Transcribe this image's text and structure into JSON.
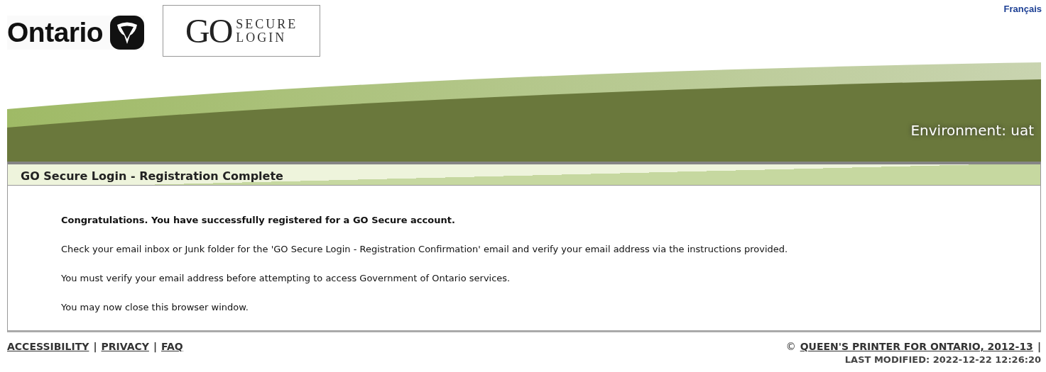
{
  "header": {
    "ontario_logo": "Ontario",
    "go_logo": {
      "mark": "GO",
      "line_1": "SECURE",
      "line_2": "LOGIN"
    },
    "language_link": "Français"
  },
  "banner": {
    "environment": "Environment: uat"
  },
  "page_title": "GO Secure Login - Registration Complete",
  "messages": [
    {
      "kind": "heading",
      "text": "Congratulations. You have successfully registered for a GO Secure account."
    },
    {
      "kind": "paragraph",
      "text": "Check your email inbox or Junk folder for the 'GO Secure Login - Registration Confirmation' email and verify your email address via the instructions provided."
    },
    {
      "kind": "paragraph",
      "text": "You must verify your email address before attempting to access Government of Ontario services."
    },
    {
      "kind": "paragraph",
      "text": "You may now close this browser window."
    }
  ],
  "footer": {
    "links": [
      "ACCESSIBILITY",
      "PRIVACY",
      "FAQ"
    ],
    "separator": "|",
    "copyright_symbol": "©",
    "copyright_link": "QUEEN'S PRINTER FOR ONTARIO, 2012-13",
    "last_modified": "LAST MODIFIED: 2022-12-22 12:26:20"
  }
}
